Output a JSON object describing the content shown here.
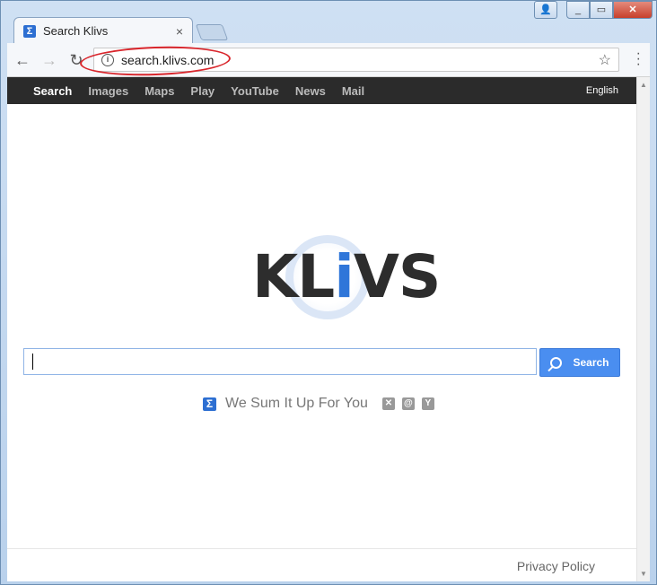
{
  "browser": {
    "tab_title": "Search Klivs",
    "tab_close": "×",
    "url": "search.klivs.com",
    "win_user": "👤",
    "win_minimize": "▭",
    "win_close": "✕"
  },
  "topnav": {
    "items": [
      "Search",
      "Images",
      "Maps",
      "Play",
      "YouTube",
      "News",
      "Mail"
    ],
    "language": "English"
  },
  "logo": {
    "prefix": "KL",
    "highlight": "i",
    "suffix": "VS"
  },
  "search": {
    "value": "",
    "button_label": "Search"
  },
  "tagline": {
    "text": "We Sum It Up For You"
  },
  "footer": {
    "privacy_label": "Privacy Policy"
  },
  "colors": {
    "accent": "#4a8ef0",
    "nav_bg": "#2b2b2b",
    "url_highlight": "#d9262c"
  }
}
